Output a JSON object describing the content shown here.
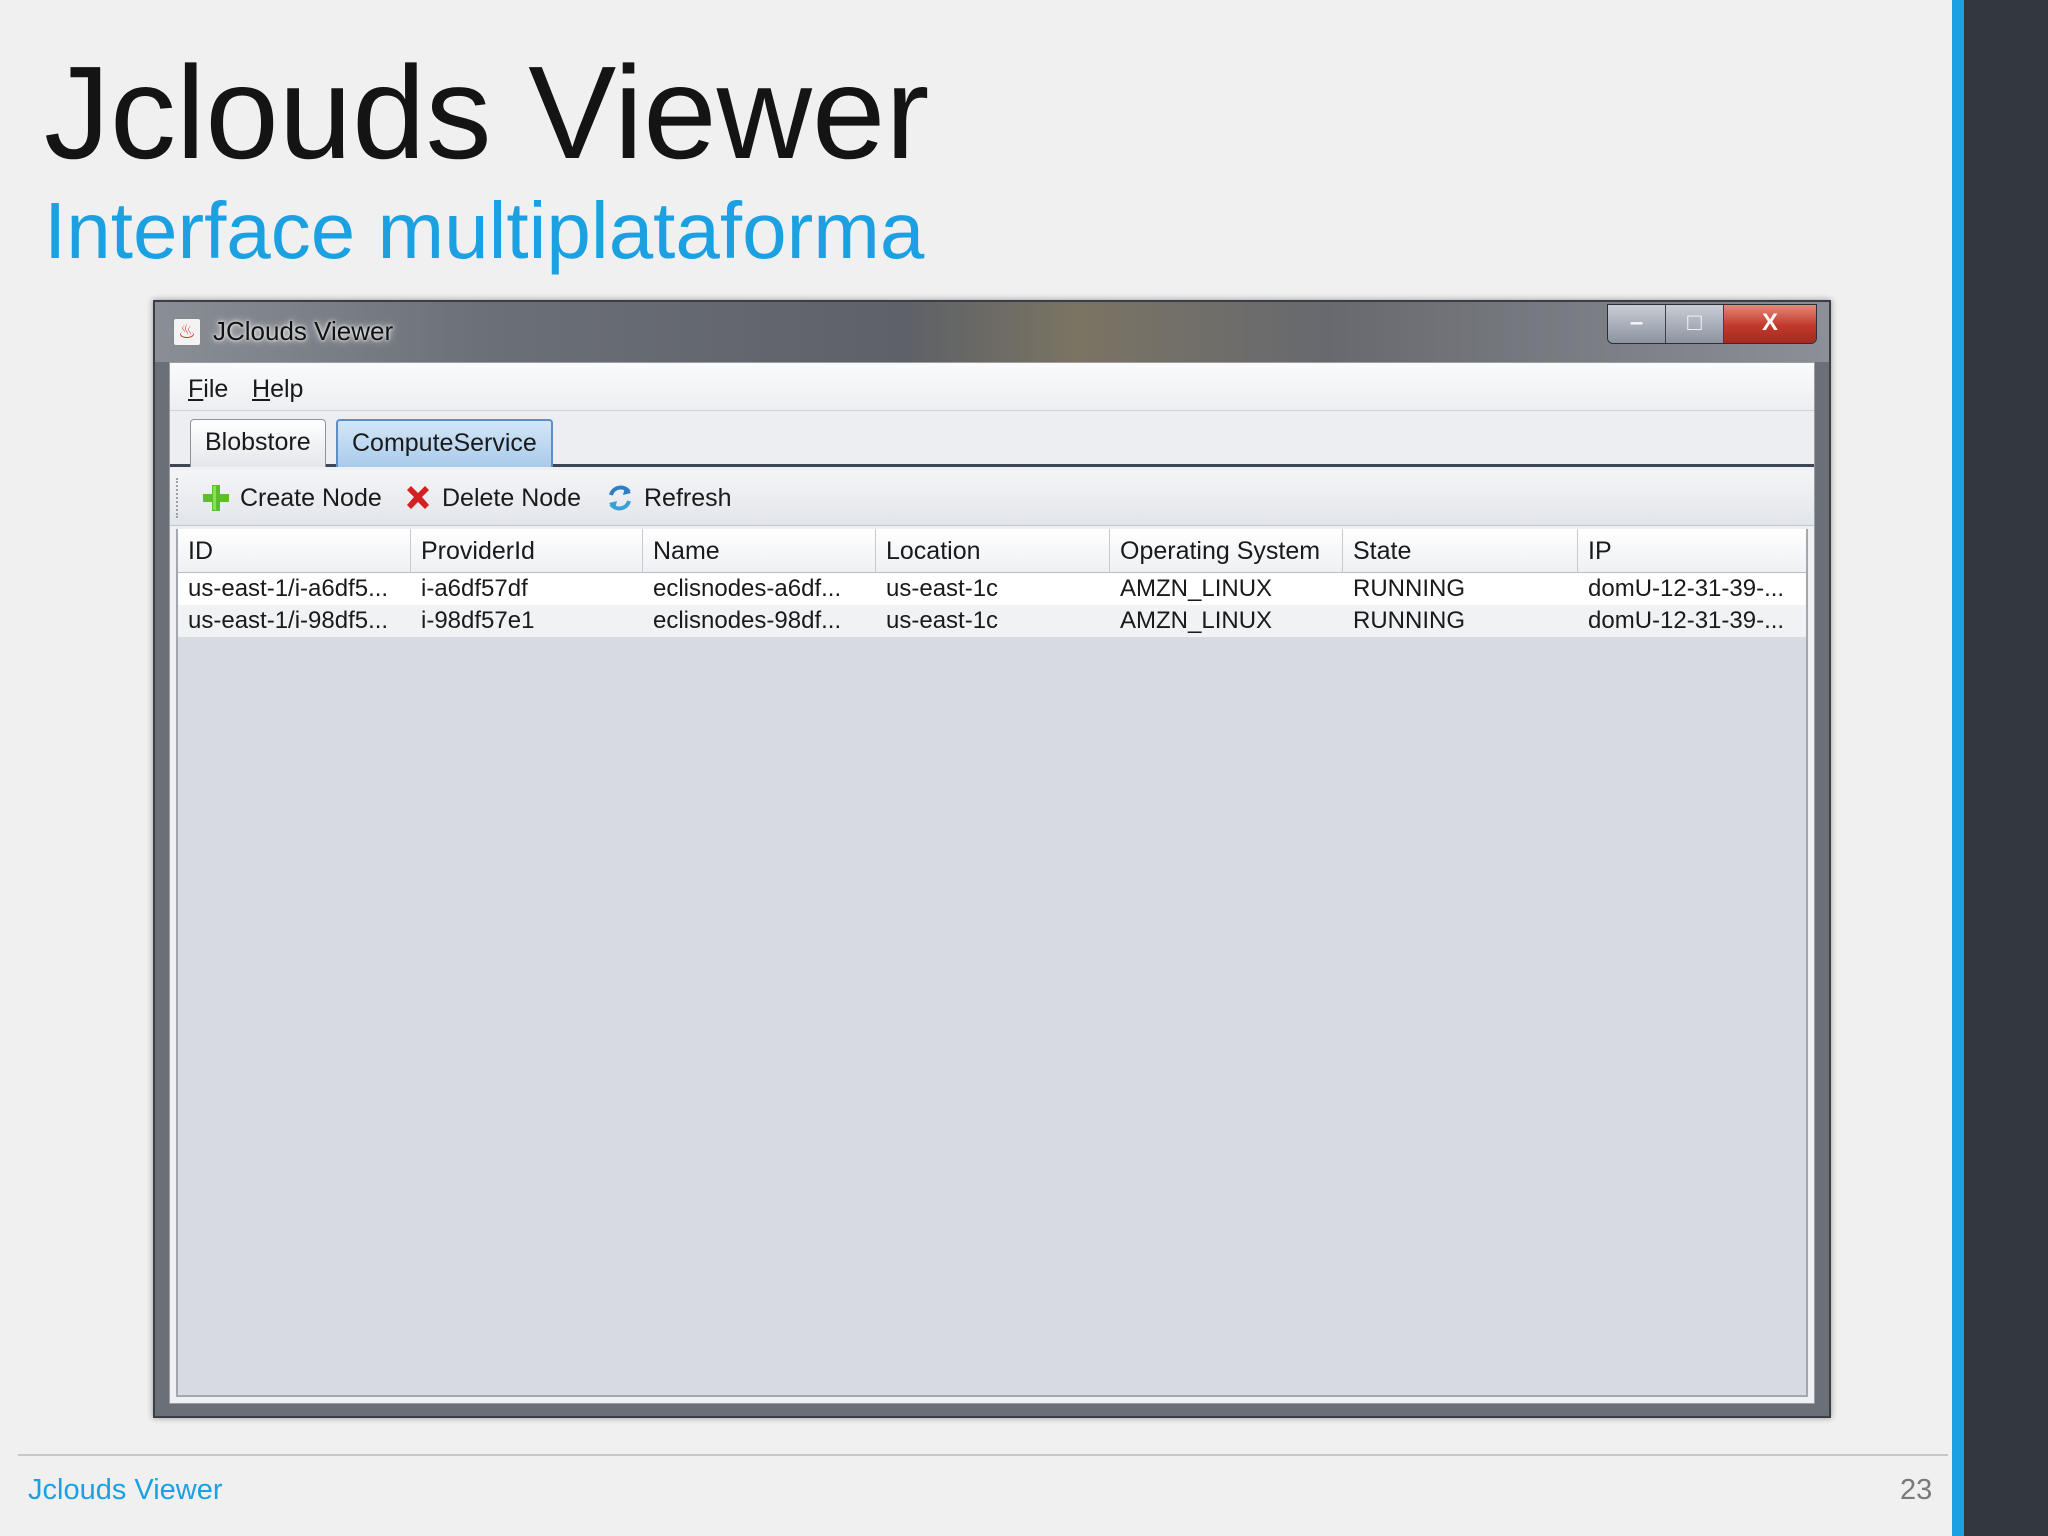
{
  "slide": {
    "title": "Jclouds Viewer",
    "subtitle": "Interface multiplataforma",
    "footer_text": "Jclouds Viewer",
    "page_number": "23",
    "accent_color": "#1ba1e2",
    "sidebar_color": "#32383e"
  },
  "window": {
    "title": "JClouds Viewer",
    "controls": {
      "minimize": "–",
      "maximize": "□",
      "close": "X"
    }
  },
  "menubar": {
    "file": {
      "mnemonic": "F",
      "rest": "ile"
    },
    "help": {
      "mnemonic": "H",
      "rest": "elp"
    }
  },
  "tabs": [
    {
      "label": "Blobstore",
      "active": false
    },
    {
      "label": "ComputeService",
      "active": true
    }
  ],
  "toolbar": {
    "create_node": "Create Node",
    "delete_node": "Delete Node",
    "refresh": "Refresh",
    "icons": [
      "plus-icon",
      "delete-x-icon",
      "refresh-icon"
    ]
  },
  "table": {
    "columns": [
      "ID",
      "ProviderId",
      "Name",
      "Location",
      "Operating System",
      "State",
      "IP"
    ],
    "rows": [
      [
        "us-east-1/i-a6df5...",
        "i-a6df57df",
        "eclisnodes-a6df...",
        "us-east-1c",
        "AMZN_LINUX",
        "RUNNING",
        "domU-12-31-39-..."
      ],
      [
        "us-east-1/i-98df5...",
        "i-98df57e1",
        "eclisnodes-98df...",
        "us-east-1c",
        "AMZN_LINUX",
        "RUNNING",
        "domU-12-31-39-..."
      ]
    ]
  }
}
